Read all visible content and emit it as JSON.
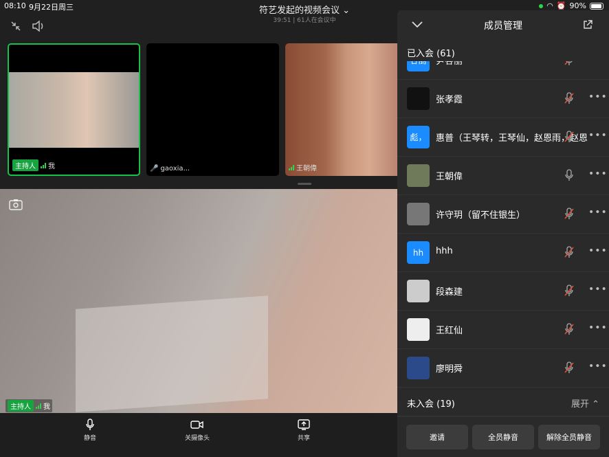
{
  "status": {
    "time": "08:10",
    "date": "9月22日周三",
    "battery": "90%"
  },
  "meeting": {
    "title": "符艺发起的视频会议",
    "duration": "39:51",
    "count": "61人在会议中"
  },
  "tiles": [
    {
      "host_label": "主持人",
      "name": "我"
    },
    {
      "name": "gaoxia..."
    },
    {
      "name": "王朝偉"
    }
  ],
  "main_label": {
    "host": "主持人",
    "name": "我"
  },
  "bottom": {
    "mute": "静音",
    "camera": "关摄像头",
    "share": "共享"
  },
  "panel": {
    "title": "成员管理",
    "joined": "已入会 (61)",
    "not_joined": "未入会 (19)",
    "expand": "展开",
    "members": [
      {
        "name": "尹谷丽",
        "avatar_text": "谷丽",
        "avatar_color": "#1a8cff",
        "mic": "muted"
      },
      {
        "name": "张孝霞",
        "avatar_text": "",
        "avatar_color": "#111111",
        "mic": "muted"
      },
      {
        "name": "惠普（王琴转，王琴仙，赵恩雨，赵恩雪",
        "avatar_text": "彪，",
        "avatar_color": "#1a8cff",
        "mic": "muted"
      },
      {
        "name": "王朝偉",
        "avatar_text": "",
        "avatar_color": "#6f7a5a",
        "mic": "on"
      },
      {
        "name": "许守玥（留不住银生）",
        "avatar_text": "",
        "avatar_color": "#777777",
        "mic": "muted"
      },
      {
        "name": "hhh",
        "avatar_text": "hh",
        "avatar_color": "#1a8cff",
        "mic": "muted"
      },
      {
        "name": "段森建",
        "avatar_text": "",
        "avatar_color": "#cccccc",
        "mic": "muted"
      },
      {
        "name": "王红仙",
        "avatar_text": "",
        "avatar_color": "#eeeeee",
        "mic": "muted"
      },
      {
        "name": "廖明舜",
        "avatar_text": "",
        "avatar_color": "#2a4a8a",
        "mic": "muted"
      }
    ],
    "buttons": {
      "invite": "邀请",
      "mute_all": "全员静音",
      "unmute_all": "解除全员静音"
    }
  }
}
